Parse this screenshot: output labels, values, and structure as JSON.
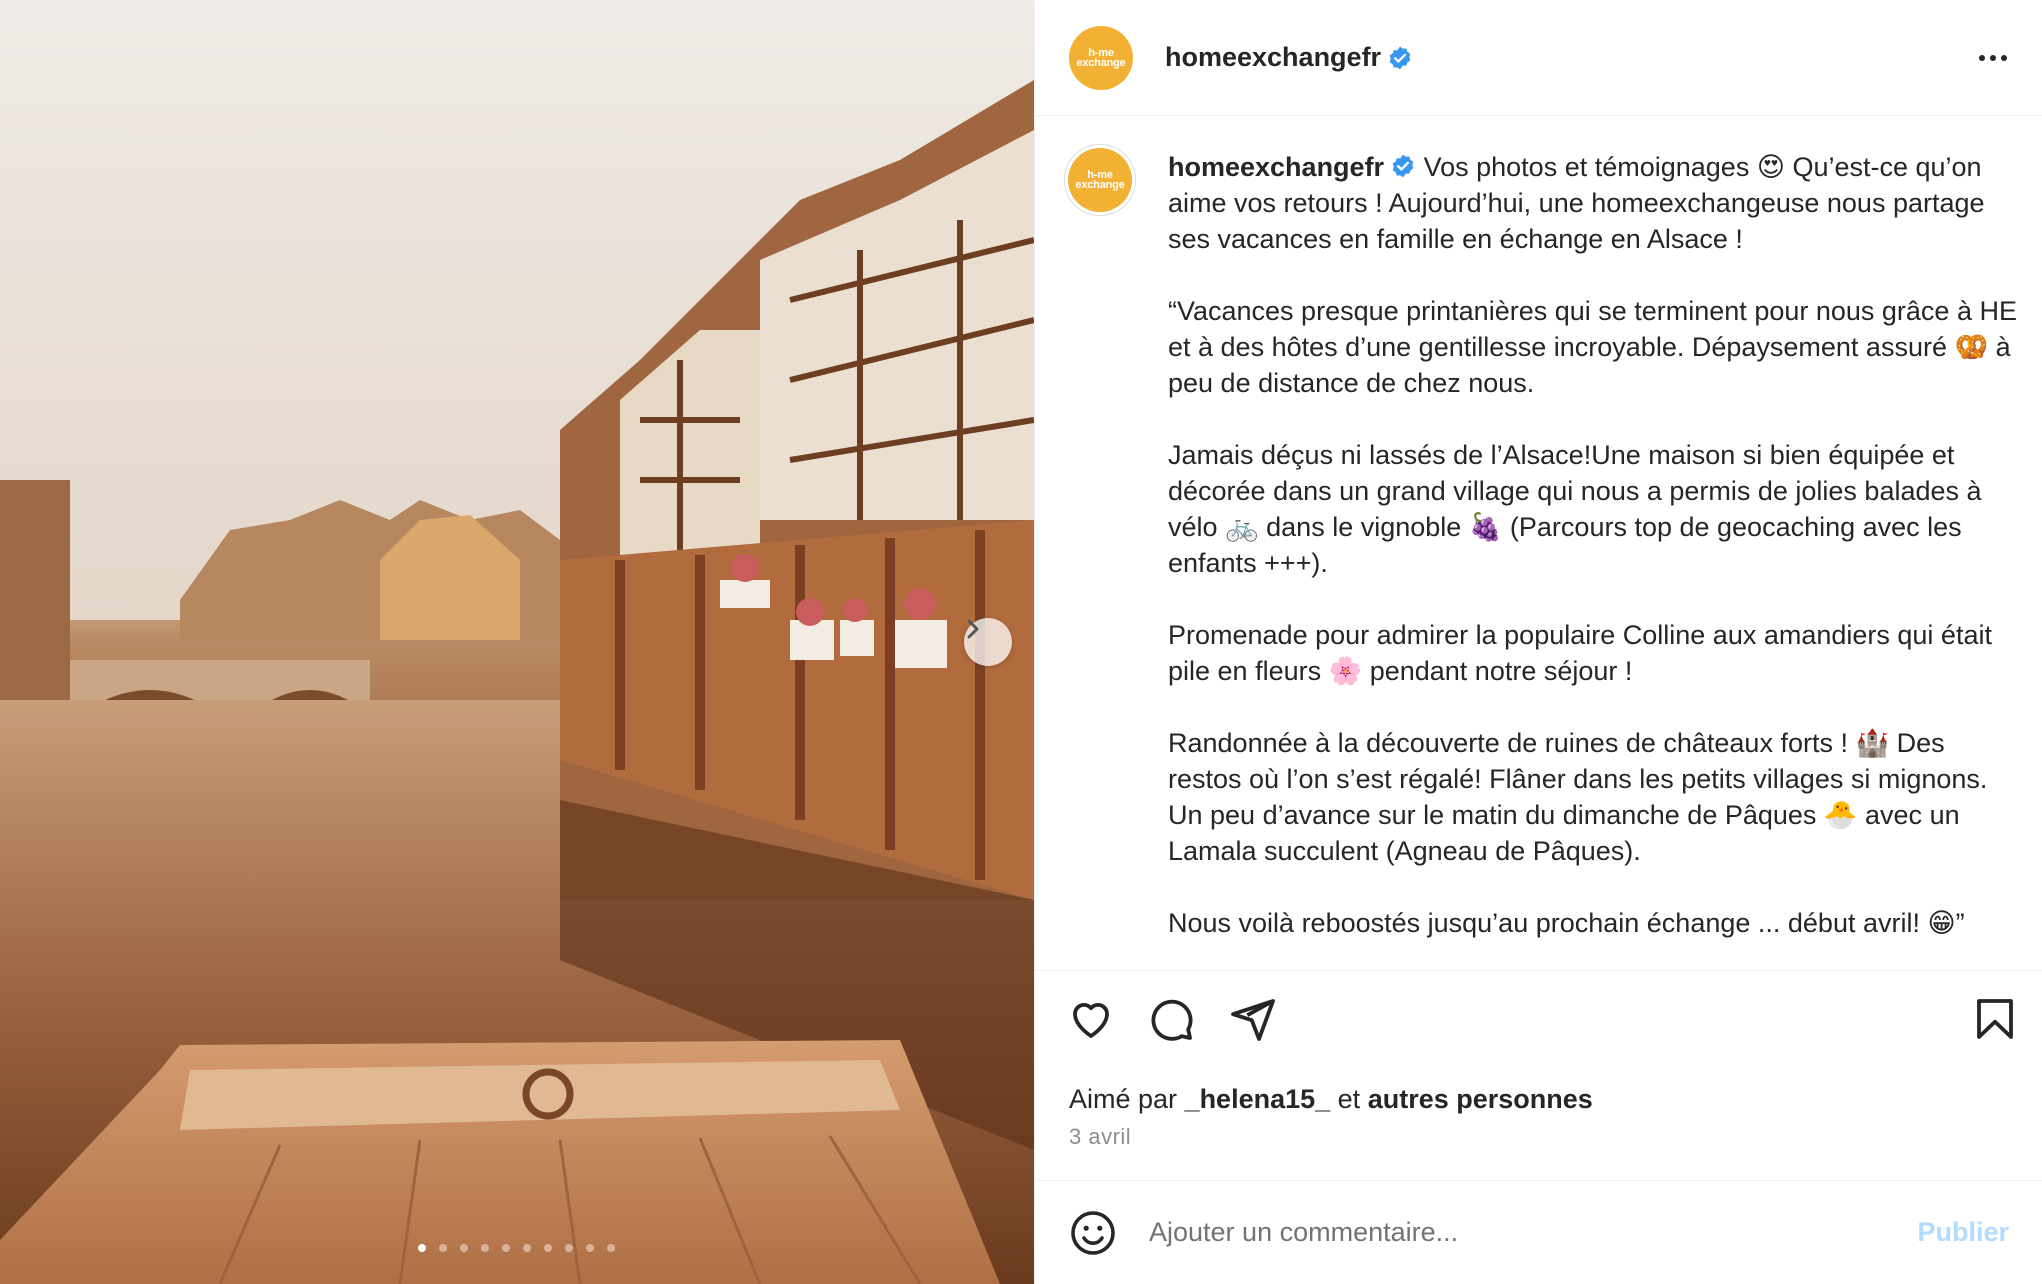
{
  "post": {
    "username": "homeexchangefr",
    "avatar_text": "h-me exchange",
    "caption_paragraphs": [
      "Vos photos et témoignages 😍 Qu’est-ce qu’on aime vos retours ! Aujourd’hui, une homeexchangeuse nous partage ses vacances en famille en échange en Alsace !",
      "“Vacances presque printanières qui se terminent pour nous grâce à HE et à des hôtes d’une gentillesse incroyable. Dépaysement assuré 🥨 à peu de distance de chez nous.",
      "Jamais déçus ni lassés de l’Alsace!Une maison si bien équipée et décorée dans un grand village qui nous a permis de jolies balades à vélo 🚲 dans le vignoble 🍇 (Parcours top de geocaching avec les enfants +++).",
      "Promenade pour admirer la populaire Colline aux amandiers qui était pile en fleurs 🌸 pendant notre séjour !",
      "Randonnée à la découverte de ruines de châteaux forts ! 🏰 Des restos où l’on s’est régalé! Flâner dans les petits villages si mignons. Un peu d’avance sur le matin du dimanche de Pâques 🐣 avec un Lamala succulent (Agneau de Pâques).",
      "Nous voilà reboostés jusqu’au prochain échange ... début avril! 😁”"
    ],
    "liked_prefix": "Aimé par ",
    "liked_user": "_helena15_",
    "liked_middle": " et ",
    "liked_others": "autres personnes",
    "date": "3 avril",
    "carousel": {
      "total": 10,
      "current": 1
    }
  },
  "comment": {
    "placeholder": "Ajouter un commentaire...",
    "publish_label": "Publier"
  },
  "icons": {
    "like": "heart-icon",
    "comment": "comment-icon",
    "share": "send-icon",
    "save": "bookmark-icon",
    "emoji": "emoji-icon",
    "verified": "verified-badge-icon",
    "more": "more-options-icon",
    "next": "chevron-right-icon"
  },
  "colors": {
    "brand_avatar": "#f2b134",
    "verified": "#3897f0",
    "publish_disabled": "#b3dbff"
  }
}
